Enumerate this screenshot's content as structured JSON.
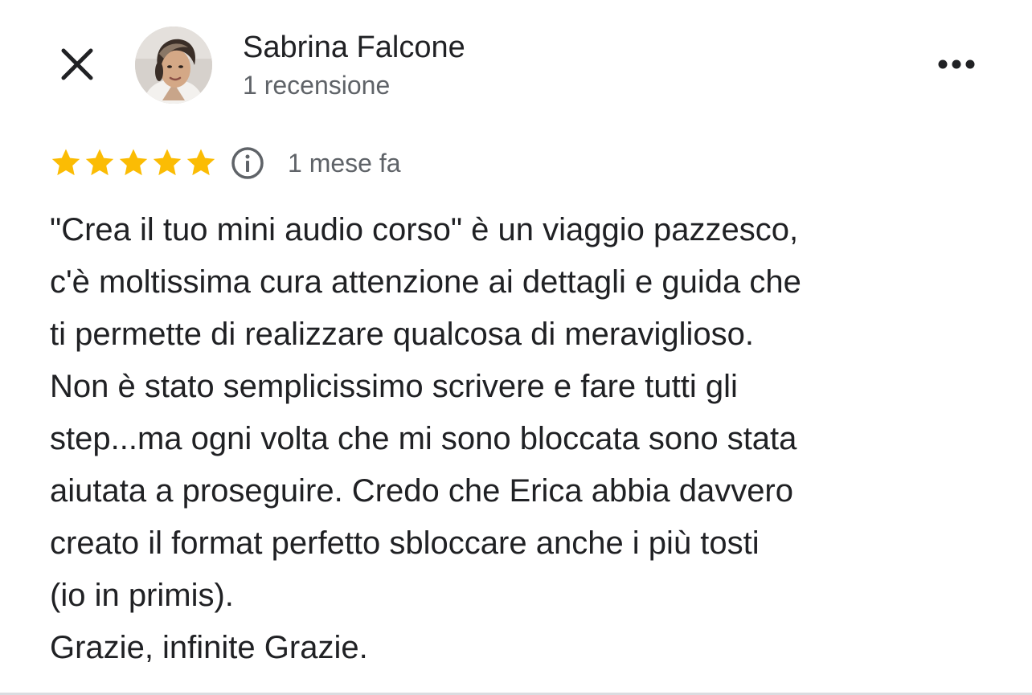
{
  "header": {
    "close_icon": "close-icon",
    "author_name": "Sabrina Falcone",
    "review_count": "1 recensione",
    "more_icon": "more-horiz-icon"
  },
  "review": {
    "rating": 5,
    "rating_max": 5,
    "star_color": "#fbbc04",
    "info_icon": "info-icon",
    "date": "1 mese fa",
    "lines": [
      "\"Crea il tuo mini audio corso\" è un viaggio pazzesco,",
      "c'è moltissima cura attenzione ai dettagli e guida che",
      "ti permette di realizzare qualcosa di meraviglioso.",
      "Non è stato semplicissimo scrivere e fare tutti gli",
      "step...ma ogni volta che mi sono bloccata sono stata",
      "aiutata a proseguire. Credo che Erica abbia davvero",
      "creato il format perfetto sbloccare anche i più tosti",
      "(io in primis).",
      "Grazie, infinite Grazie."
    ]
  }
}
